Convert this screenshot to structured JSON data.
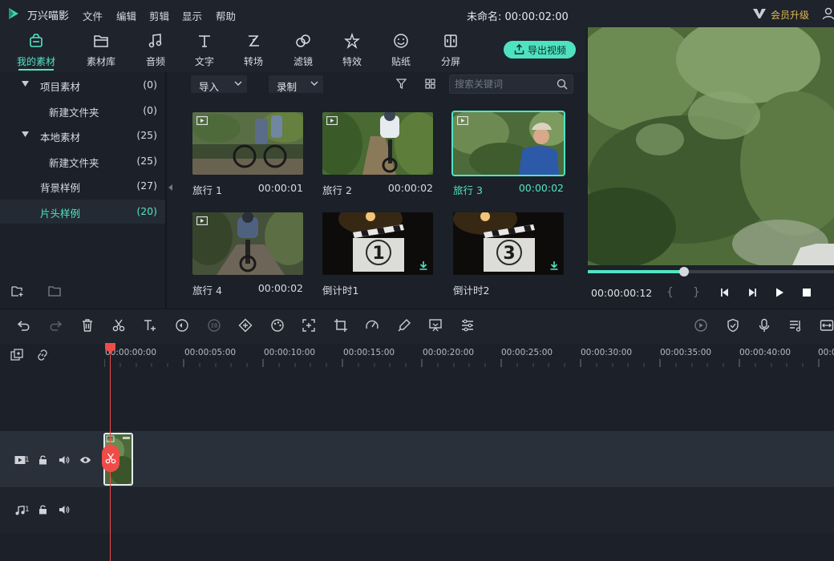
{
  "app": {
    "name": "万兴喵影",
    "project_title": "未命名: 00:00:02:00",
    "vip_label": "会员升级"
  },
  "menu": [
    "文件",
    "编辑",
    "剪辑",
    "显示",
    "帮助"
  ],
  "tabs": [
    {
      "label": "我的素材",
      "icon": "my-media-icon",
      "active": true
    },
    {
      "label": "素材库",
      "icon": "stock-media-icon"
    },
    {
      "label": "音频",
      "icon": "music-note-icon"
    },
    {
      "label": "文字",
      "icon": "text-icon"
    },
    {
      "label": "转场",
      "icon": "transition-icon"
    },
    {
      "label": "滤镜",
      "icon": "filter-circles-icon"
    },
    {
      "label": "特效",
      "icon": "effects-star-icon"
    },
    {
      "label": "贴纸",
      "icon": "sticker-smile-icon"
    },
    {
      "label": "分屏",
      "icon": "split-screen-icon"
    }
  ],
  "export_button": "导出视频",
  "sidebar": {
    "folders": [
      {
        "name": "项目素材",
        "count": "(0)",
        "expanded": true,
        "level": 0
      },
      {
        "name": "新建文件夹",
        "count": "(0)",
        "level": 1
      },
      {
        "name": "本地素材",
        "count": "(25)",
        "expanded": true,
        "level": 0
      },
      {
        "name": "新建文件夹",
        "count": "(25)",
        "level": 1
      },
      {
        "name": "背景样例",
        "count": "(27)",
        "level": 0
      },
      {
        "name": "片头样例",
        "count": "(20)",
        "level": 0,
        "active": true
      }
    ]
  },
  "media_bar": {
    "import_label": "导入",
    "record_label": "录制",
    "search_placeholder": "搜索关键词"
  },
  "media": [
    {
      "name": "旅行 1",
      "duration": "00:00:01"
    },
    {
      "name": "旅行 2",
      "duration": "00:00:02"
    },
    {
      "name": "旅行 3",
      "duration": "00:00:02",
      "selected": true
    },
    {
      "name": "旅行 4",
      "duration": "00:00:02"
    },
    {
      "name": "倒计时1",
      "duration": "",
      "countdown": "1"
    },
    {
      "name": "倒计时2",
      "duration": "",
      "countdown": "3"
    }
  ],
  "preview": {
    "time": "00:00:00:12",
    "progress": 0.39,
    "mark_in": "{",
    "mark_out": "}"
  },
  "timeline": {
    "ruler": [
      "00:00:00:00",
      "00:00:05:00",
      "00:00:10:00",
      "00:00:15:00",
      "00:00:20:00",
      "00:00:25:00",
      "00:00:30:00",
      "00:00:35:00",
      "00:00:40:00",
      "00:0"
    ],
    "video_track_number": "1",
    "audio_track_number": "1"
  },
  "colors": {
    "accent": "#51e4c4",
    "playhead": "#ef4c49",
    "vip": "#e5b94b"
  }
}
